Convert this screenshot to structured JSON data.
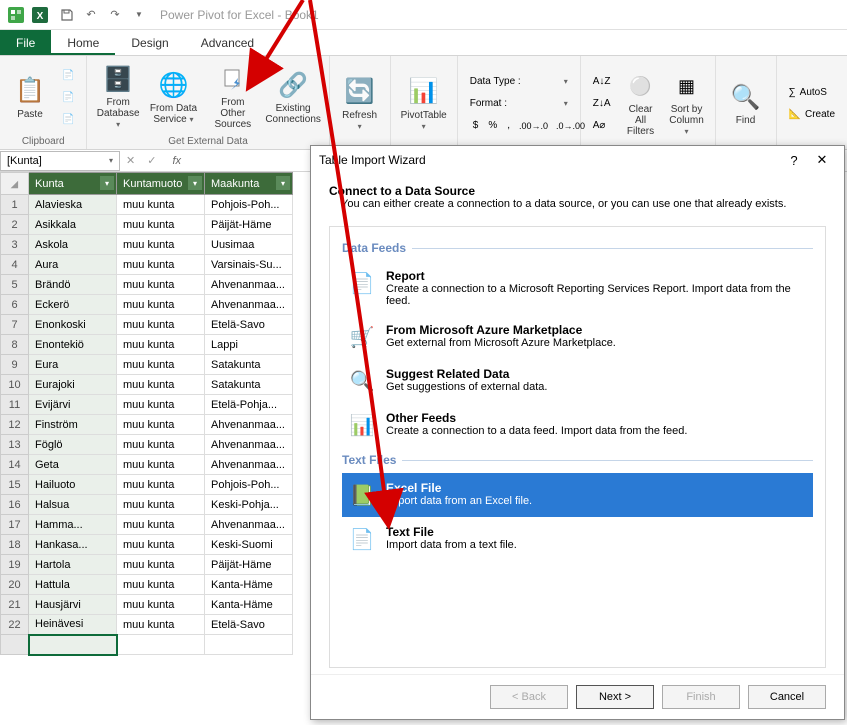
{
  "title": "Power Pivot for Excel - Book1",
  "tabs": {
    "file": "File",
    "home": "Home",
    "design": "Design",
    "advanced": "Advanced"
  },
  "ribbon": {
    "clipboard": {
      "paste": "Paste",
      "group": "Clipboard"
    },
    "getdata": {
      "db": "From\nDatabase",
      "service": "From Data\nService",
      "other": "From Other\nSources",
      "existing": "Existing\nConnections",
      "group": "Get External Data"
    },
    "refresh": "Refresh",
    "pivot": "PivotTable",
    "formatting": {
      "datatype": "Data Type :",
      "format": "Format :",
      "currency": "$",
      "pct": "%",
      "comma": ","
    },
    "sort": {
      "clear": "Clear All\nFilters",
      "sortby": "Sort by\nColumn"
    },
    "find": "Find",
    "calc": {
      "autosum": "AutoS",
      "create": "Create"
    }
  },
  "namebox": "[Kunta]",
  "columns": [
    "Kunta",
    "Kuntamuoto",
    "Maakunta"
  ],
  "rows": [
    [
      "Alavieska",
      "muu kunta",
      "Pohjois-Poh..."
    ],
    [
      "Asikkala",
      "muu kunta",
      "Päijät-Häme"
    ],
    [
      "Askola",
      "muu kunta",
      "Uusimaa"
    ],
    [
      "Aura",
      "muu kunta",
      "Varsinais-Su..."
    ],
    [
      "Brändö",
      "muu kunta",
      "Ahvenanmaa..."
    ],
    [
      "Eckerö",
      "muu kunta",
      "Ahvenanmaa..."
    ],
    [
      "Enonkoski",
      "muu kunta",
      "Etelä-Savo"
    ],
    [
      "Enontekiö",
      "muu kunta",
      "Lappi"
    ],
    [
      "Eura",
      "muu kunta",
      "Satakunta"
    ],
    [
      "Eurajoki",
      "muu kunta",
      "Satakunta"
    ],
    [
      "Evijärvi",
      "muu kunta",
      "Etelä-Pohja..."
    ],
    [
      "Finström",
      "muu kunta",
      "Ahvenanmaa..."
    ],
    [
      "Föglö",
      "muu kunta",
      "Ahvenanmaa..."
    ],
    [
      "Geta",
      "muu kunta",
      "Ahvenanmaa..."
    ],
    [
      "Hailuoto",
      "muu kunta",
      "Pohjois-Poh..."
    ],
    [
      "Halsua",
      "muu kunta",
      "Keski-Pohja..."
    ],
    [
      "Hamma...",
      "muu kunta",
      "Ahvenanmaa..."
    ],
    [
      "Hankasa...",
      "muu kunta",
      "Keski-Suomi"
    ],
    [
      "Hartola",
      "muu kunta",
      "Päijät-Häme"
    ],
    [
      "Hattula",
      "muu kunta",
      "Kanta-Häme"
    ],
    [
      "Hausjärvi",
      "muu kunta",
      "Kanta-Häme"
    ],
    [
      "Heinävesi",
      "muu kunta",
      "Etelä-Savo"
    ]
  ],
  "dialog": {
    "title": "Table Import Wizard",
    "heading": "Connect to a Data Source",
    "sub": "You can either create a connection to a data source, or you can use one that already exists.",
    "sections": {
      "feeds": {
        "title": "Data Feeds",
        "items": [
          {
            "name": "Report",
            "desc": "Create a connection to a Microsoft Reporting Services Report. Import data from the feed."
          },
          {
            "name": "From Microsoft Azure Marketplace",
            "desc": "Get external from Microsoft Azure Marketplace."
          },
          {
            "name": "Suggest Related Data",
            "desc": "Get suggestions of external data."
          },
          {
            "name": "Other Feeds",
            "desc": "Create a connection to a data feed. Import data from the feed."
          }
        ]
      },
      "text": {
        "title": "Text Files",
        "items": [
          {
            "name": "Excel File",
            "desc": "Import data from an Excel file."
          },
          {
            "name": "Text File",
            "desc": "Import data from a text file."
          }
        ]
      }
    },
    "buttons": {
      "back": "< Back",
      "next": "Next >",
      "finish": "Finish",
      "cancel": "Cancel"
    }
  }
}
